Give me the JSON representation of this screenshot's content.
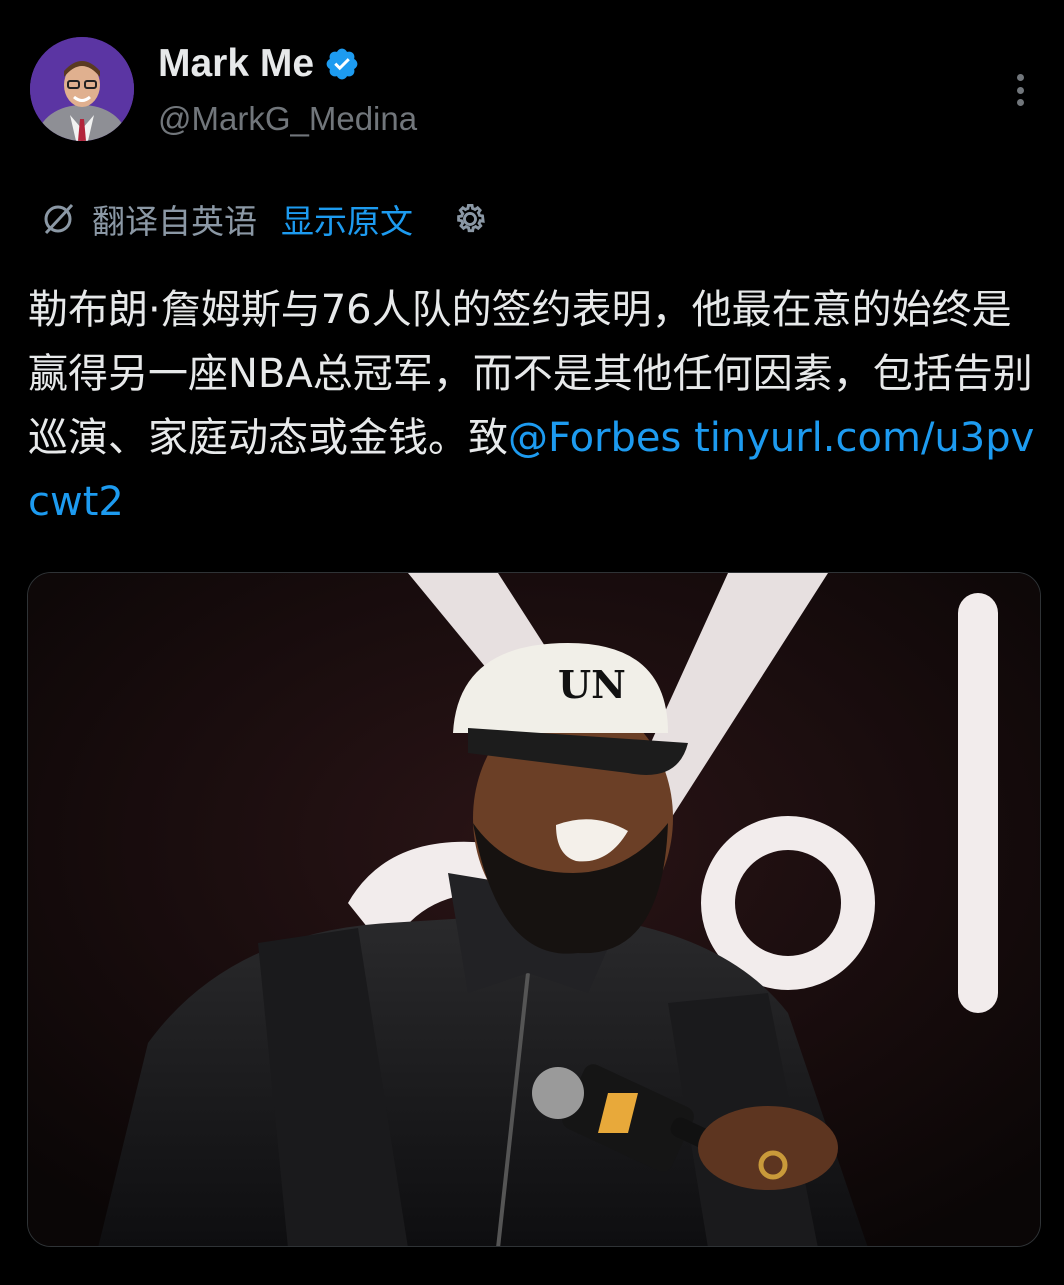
{
  "author": {
    "display_name": "Mark Me",
    "handle": "@MarkG_Medina",
    "verified": true,
    "avatar_icon": "profile-photo"
  },
  "translation": {
    "label": "翻译自英语",
    "show_original": "显示原文",
    "icon": "translate-icon",
    "settings_icon": "gear-icon"
  },
  "tweet": {
    "text_main": "勒布朗·詹姆斯与76人队的签约表明，他最在意的始终是赢得另一座NBA总冠军，而不是其他任何因素，包括告别巡演、家庭动态或金钱。致",
    "mention": "@Forbes",
    "url": "tinyurl.com/u3pvcwt2"
  },
  "media": {
    "cap_text": "UN",
    "description_icon": "photo"
  },
  "colors": {
    "background": "#000000",
    "text": "#e7e9ea",
    "secondary": "#71767b",
    "link": "#1d9bf0",
    "verified": "#1d9bf0"
  }
}
